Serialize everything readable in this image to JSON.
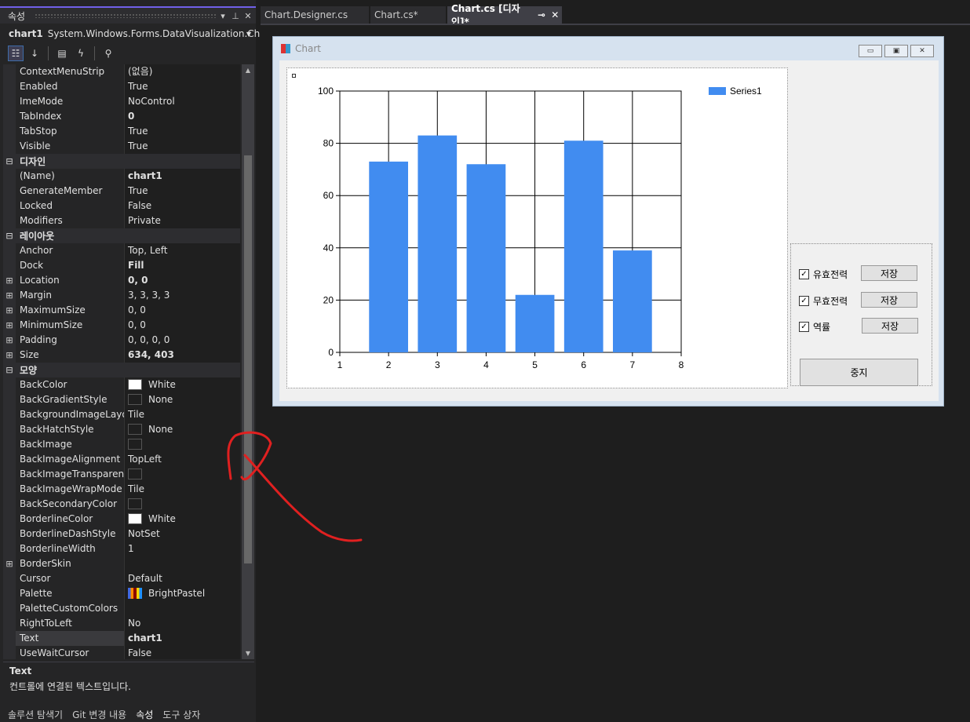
{
  "props_panel": {
    "title": "속성",
    "object_name": "chart1",
    "object_type": "System.Windows.Forms.DataVisualization.Chart",
    "rows": [
      {
        "kind": "prop",
        "name": "ContextMenuStrip",
        "value": "(없음)"
      },
      {
        "kind": "prop",
        "name": "Enabled",
        "value": "True"
      },
      {
        "kind": "prop",
        "name": "ImeMode",
        "value": "NoControl"
      },
      {
        "kind": "prop",
        "name": "TabIndex",
        "value": "0",
        "bold": true
      },
      {
        "kind": "prop",
        "name": "TabStop",
        "value": "True"
      },
      {
        "kind": "prop",
        "name": "Visible",
        "value": "True"
      },
      {
        "kind": "cat",
        "name": "디자인"
      },
      {
        "kind": "prop",
        "name": "(Name)",
        "value": "chart1",
        "bold": true
      },
      {
        "kind": "prop",
        "name": "GenerateMember",
        "value": "True"
      },
      {
        "kind": "prop",
        "name": "Locked",
        "value": "False"
      },
      {
        "kind": "prop",
        "name": "Modifiers",
        "value": "Private"
      },
      {
        "kind": "cat",
        "name": "레이아웃"
      },
      {
        "kind": "prop",
        "name": "Anchor",
        "value": "Top, Left"
      },
      {
        "kind": "prop",
        "name": "Dock",
        "value": "Fill",
        "bold": true
      },
      {
        "kind": "prop",
        "name": "Location",
        "value": "0, 0",
        "bold": true,
        "expand": true
      },
      {
        "kind": "prop",
        "name": "Margin",
        "value": "3, 3, 3, 3",
        "expand": true
      },
      {
        "kind": "prop",
        "name": "MaximumSize",
        "value": "0, 0",
        "expand": true
      },
      {
        "kind": "prop",
        "name": "MinimumSize",
        "value": "0, 0",
        "expand": true
      },
      {
        "kind": "prop",
        "name": "Padding",
        "value": "0, 0, 0, 0",
        "expand": true
      },
      {
        "kind": "prop",
        "name": "Size",
        "value": "634, 403",
        "bold": true,
        "expand": true
      },
      {
        "kind": "cat",
        "name": "모양"
      },
      {
        "kind": "prop",
        "name": "BackColor",
        "value": "White",
        "swatch": "#ffffff"
      },
      {
        "kind": "prop",
        "name": "BackGradientStyle",
        "value": "None",
        "swatch": "#1f1f1f"
      },
      {
        "kind": "prop",
        "name": "BackgroundImageLayout",
        "value": "Tile"
      },
      {
        "kind": "prop",
        "name": "BackHatchStyle",
        "value": "None",
        "swatch": "#1f1f1f"
      },
      {
        "kind": "prop",
        "name": "BackImage",
        "value": "",
        "swatch": "#1f1f1f"
      },
      {
        "kind": "prop",
        "name": "BackImageAlignment",
        "value": "TopLeft"
      },
      {
        "kind": "prop",
        "name": "BackImageTransparentCc",
        "value": "",
        "swatch": "#1f1f1f"
      },
      {
        "kind": "prop",
        "name": "BackImageWrapMode",
        "value": "Tile"
      },
      {
        "kind": "prop",
        "name": "BackSecondaryColor",
        "value": "",
        "swatch": "#1f1f1f"
      },
      {
        "kind": "prop",
        "name": "BorderlineColor",
        "value": "White",
        "swatch": "#ffffff"
      },
      {
        "kind": "prop",
        "name": "BorderlineDashStyle",
        "value": "NotSet"
      },
      {
        "kind": "prop",
        "name": "BorderlineWidth",
        "value": "1"
      },
      {
        "kind": "prop",
        "name": "BorderSkin",
        "value": "",
        "expand": true
      },
      {
        "kind": "prop",
        "name": "Cursor",
        "value": "Default"
      },
      {
        "kind": "prop",
        "name": "Palette",
        "value": "BrightPastel",
        "palette": true
      },
      {
        "kind": "prop",
        "name": "PaletteCustomColors",
        "value": ""
      },
      {
        "kind": "prop",
        "name": "RightToLeft",
        "value": "No"
      },
      {
        "kind": "prop",
        "name": "Text",
        "value": "chart1",
        "bold": true,
        "selected": true
      },
      {
        "kind": "prop",
        "name": "UseWaitCursor",
        "value": "False"
      }
    ],
    "desc_title": "Text",
    "desc_text": "컨트롤에 연결된 텍스트입니다.",
    "bottom_tabs": [
      "솔루션 탐색기",
      "Git 변경 내용",
      "속성",
      "도구 상자"
    ],
    "active_bottom_tab": 2
  },
  "doc_tabs": [
    {
      "label": "Chart.Designer.cs",
      "active": false,
      "pin": false
    },
    {
      "label": "Chart.cs*",
      "active": false,
      "pin": false
    },
    {
      "label": "Chart.cs [디자인]*",
      "active": true,
      "pin": true
    }
  ],
  "form": {
    "title": "Chart",
    "checkboxes": [
      {
        "label": "유효전력",
        "checked": true,
        "button": "저장"
      },
      {
        "label": "무효전력",
        "checked": true,
        "button": "저장"
      },
      {
        "label": "역률",
        "checked": true,
        "button": "저장"
      }
    ],
    "stop_button": "중지"
  },
  "chart_data": {
    "type": "bar",
    "x": [
      2,
      3,
      4,
      5,
      6,
      7
    ],
    "series": [
      {
        "name": "Series1",
        "values": [
          73,
          83,
          72,
          22,
          81,
          39
        ],
        "color": "#418cf0"
      }
    ],
    "xlim": [
      1,
      8
    ],
    "ylim": [
      0,
      100
    ],
    "xticks": [
      1,
      2,
      3,
      4,
      5,
      6,
      7,
      8
    ],
    "yticks": [
      0,
      20,
      40,
      60,
      80,
      100
    ],
    "grid": true,
    "legend_position": "top-right"
  },
  "colors": {
    "accent": "#7160e8",
    "bar": "#418cf0",
    "annotation": "#e02020"
  }
}
